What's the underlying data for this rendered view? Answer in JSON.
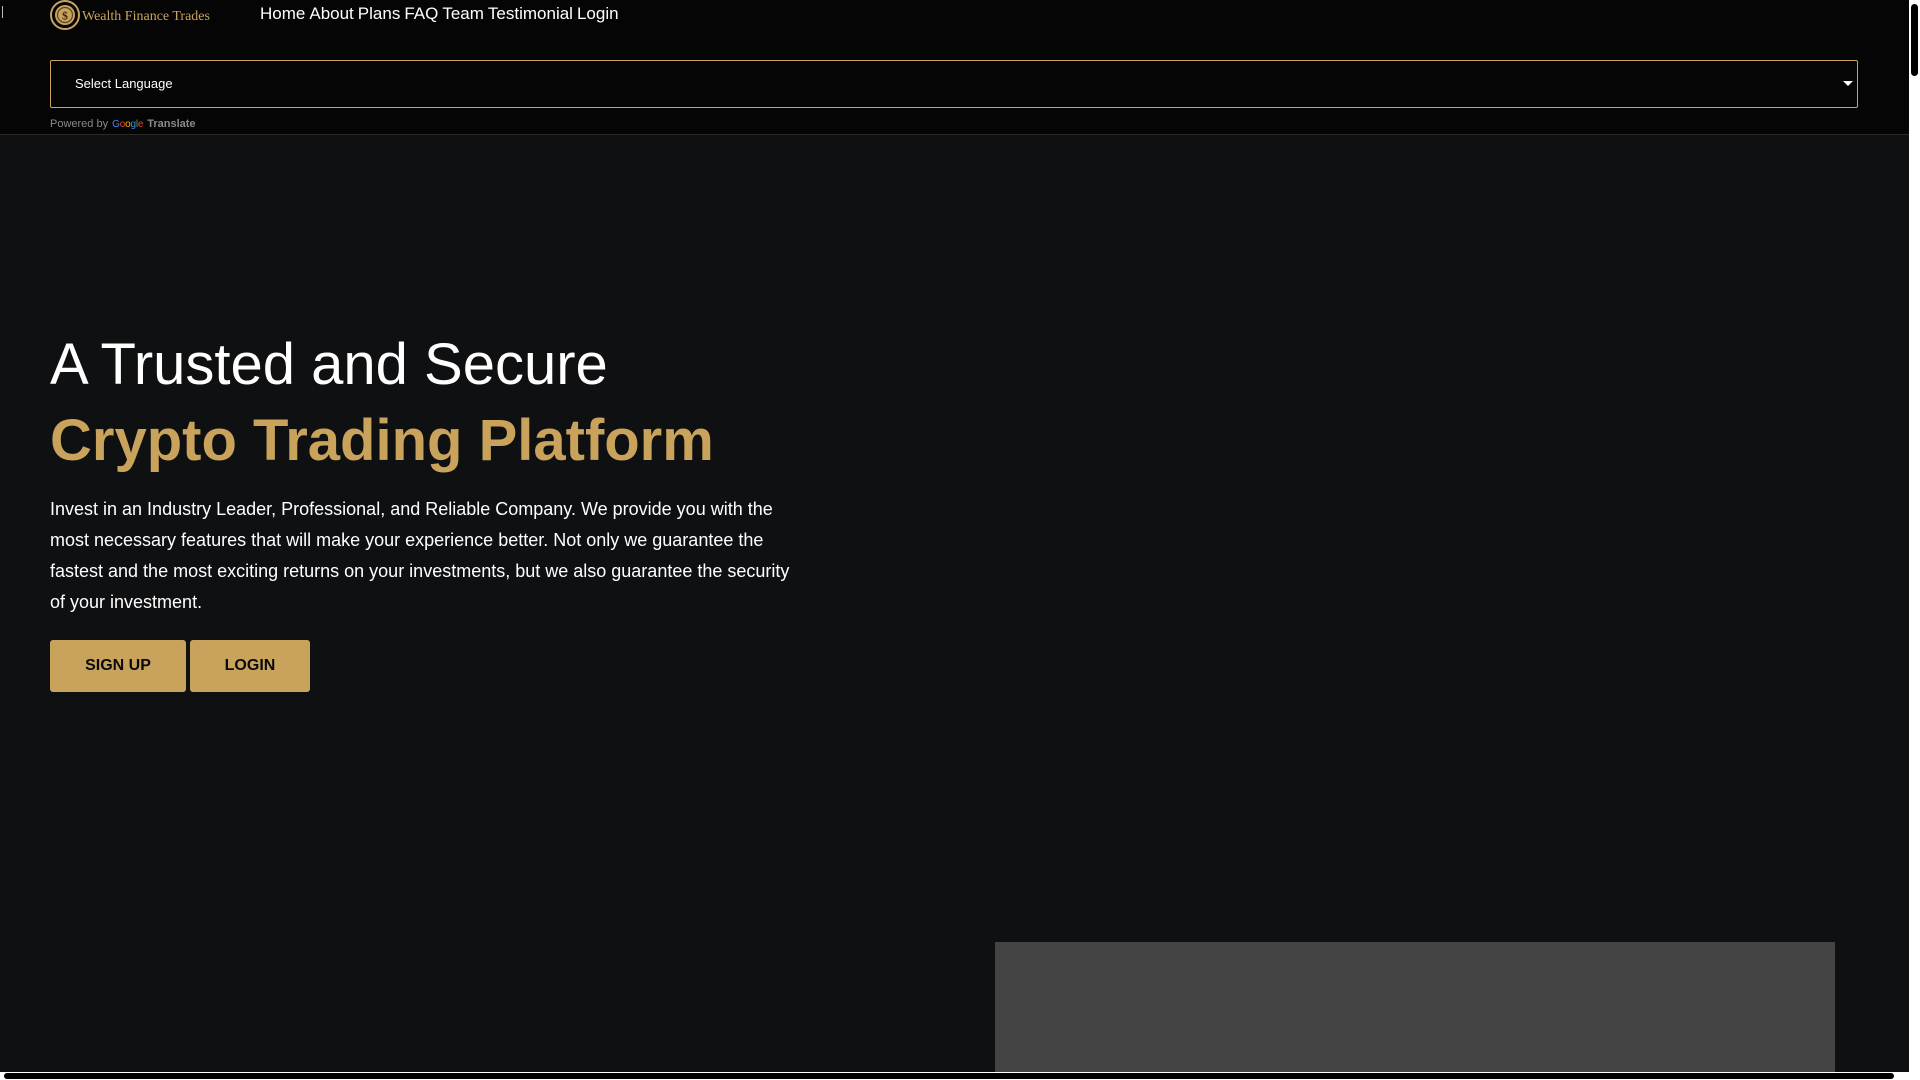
{
  "brand": {
    "name": "Wealth Finance Trades",
    "accent_color": "#c9a35c",
    "logo_icon": "gold-coin-icon"
  },
  "nav": {
    "items": [
      "Home",
      "About",
      "Plans",
      "FAQ",
      "Team",
      "Testimonial",
      "Login"
    ]
  },
  "translate": {
    "select_label": "Select Language",
    "powered_by": "Powered by",
    "google": "Google",
    "translate": "Translate"
  },
  "hero": {
    "title_line1": "A Trusted and Secure",
    "title_line2": "Crypto Trading Platform",
    "description": "Invest in an Industry Leader, Professional, and Reliable Company. We provide you with the most necessary features that will make your experience better. Not only we guarantee the fastest and the most exciting returns on your investments, but we also guarantee the security of your investment.",
    "signup_label": "SIGN UP",
    "login_label": "LOGIN"
  }
}
